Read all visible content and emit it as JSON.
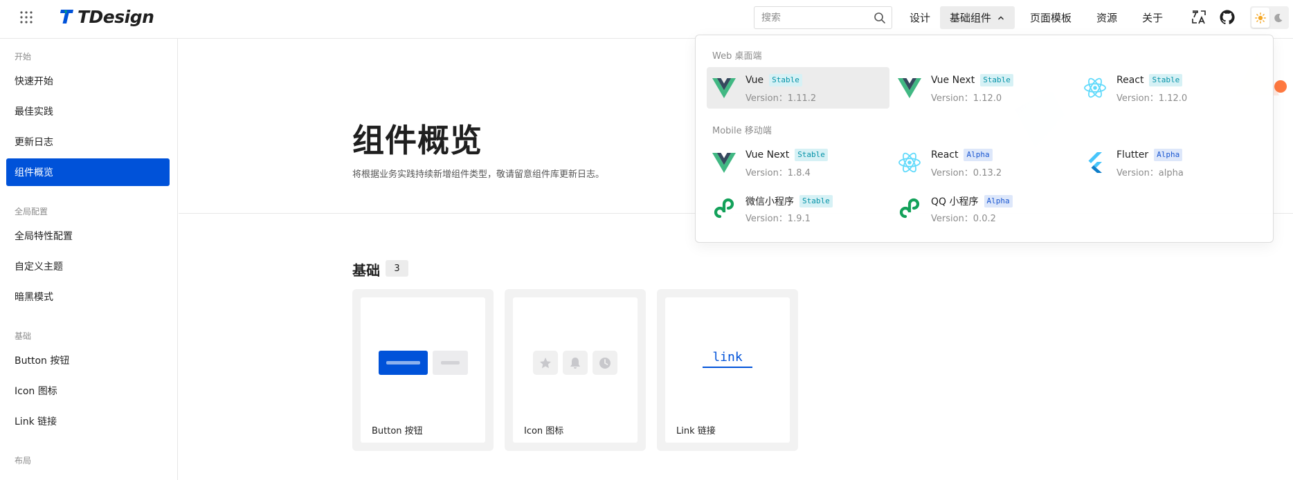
{
  "header": {
    "logo_text": "TDesign",
    "search_placeholder": "搜索",
    "nav": [
      {
        "label": "设计"
      },
      {
        "label": "基础组件"
      },
      {
        "label": "页面模板"
      },
      {
        "label": "资源"
      },
      {
        "label": "关于"
      }
    ]
  },
  "sidebar": {
    "groups": [
      {
        "title": "开始",
        "items": [
          "快速开始",
          "最佳实践",
          "更新日志",
          "组件概览"
        ]
      },
      {
        "title": "全局配置",
        "items": [
          "全局特性配置",
          "自定义主题",
          "暗黑模式"
        ]
      },
      {
        "title": "基础",
        "items": [
          "Button 按钮",
          "Icon 图标",
          "Link 链接"
        ]
      },
      {
        "title": "布局",
        "items": []
      }
    ],
    "active_item": "组件概览"
  },
  "main": {
    "title": "组件概览",
    "description": "将根据业务实践持续新增组件类型，敬请留意组件库更新日志。",
    "section": {
      "title": "基础",
      "count": "3",
      "cards": [
        {
          "label": "Button 按钮"
        },
        {
          "label": "Icon 图标"
        },
        {
          "label": "Link 链接",
          "preview_text": "link"
        }
      ]
    }
  },
  "dropdown": {
    "web_heading": "Web 桌面端",
    "mobile_heading": "Mobile 移动端",
    "web": [
      {
        "name": "Vue",
        "badge": "Stable",
        "version": "Version：1.11.2",
        "logo": "vue-logo"
      },
      {
        "name": "Vue Next",
        "badge": "Stable",
        "version": "Version：1.12.0",
        "logo": "vue-logo"
      },
      {
        "name": "React",
        "badge": "Stable",
        "version": "Version：1.12.0",
        "logo": "react-logo"
      }
    ],
    "mobile": [
      {
        "name": "Vue Next",
        "badge": "Stable",
        "version": "Version：1.8.4",
        "logo": "vue-logo"
      },
      {
        "name": "React",
        "badge": "Alpha",
        "version": "Version：0.13.2",
        "logo": "react-logo"
      },
      {
        "name": "Flutter",
        "badge": "Alpha",
        "version": "Version：alpha",
        "logo": "flutter-logo"
      },
      {
        "name": "微信小程序",
        "badge": "Stable",
        "version": "Version：1.9.1",
        "logo": "miniprogram-logo"
      },
      {
        "name": "QQ 小程序",
        "badge": "Alpha",
        "version": "Version：0.0.2",
        "logo": "miniprogram-logo"
      }
    ]
  },
  "colors": {
    "brand": "#0052d9",
    "vue_green": "#41b883",
    "vue_dark": "#35495e",
    "react_blue": "#61dafb",
    "flutter_blue": "#47c5fb",
    "miniprogram_green": "#13a15a",
    "stable_badge_bg": "#d6f1f5",
    "alpha_badge_bg": "#dde7fa"
  }
}
